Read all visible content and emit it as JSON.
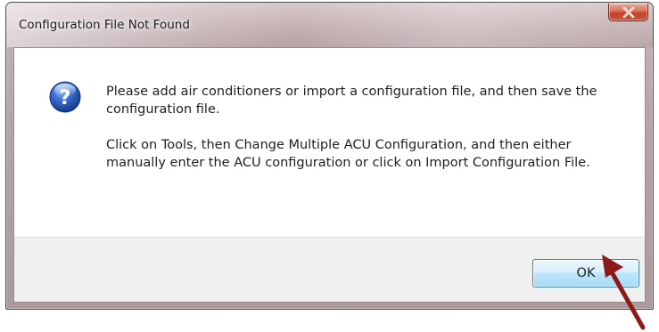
{
  "dialog": {
    "title": "Configuration File Not Found",
    "message_paragraphs": [
      "Please add air conditioners or import a configuration file, and then save the configuration file.",
      "Click on Tools, then Change Multiple ACU Configuration, and then either manually enter the ACU configuration or click on Import Configuration File."
    ],
    "icon": "question-icon",
    "ok_label": "OK",
    "close_icon": "close-icon"
  },
  "annotation": {
    "icon": "pointer-arrow",
    "color": "#8b1a1a"
  },
  "colors": {
    "close_button": "#c8553c",
    "question_icon": "#1f4fa6",
    "ok_button_border": "#3c7fb1"
  }
}
